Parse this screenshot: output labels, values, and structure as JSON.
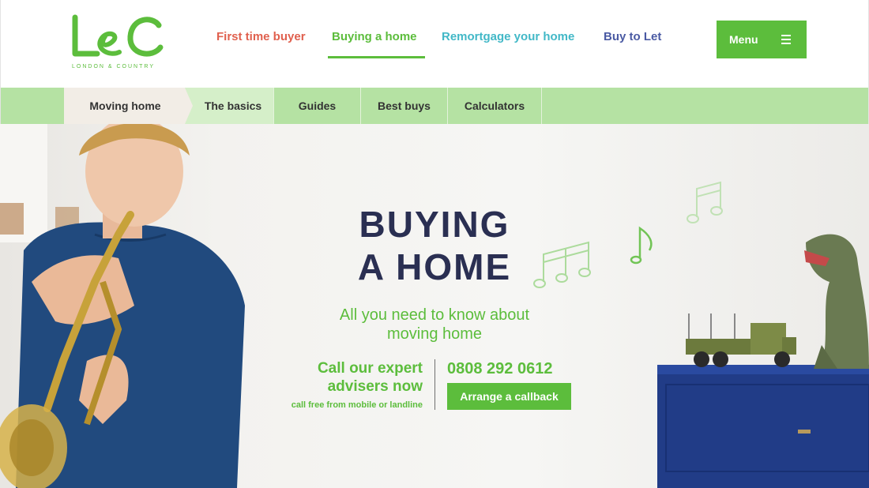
{
  "brand": {
    "logo_letters": "L&C",
    "logo_tagline": "LONDON & COUNTRY"
  },
  "colors": {
    "green": "#5cbd3c",
    "red": "#e0604e",
    "teal": "#42b8c7",
    "navy": "#4a5aa3",
    "title": "#2a2f52"
  },
  "topnav": {
    "items": [
      {
        "label": "First time buyer"
      },
      {
        "label": "Buying a home",
        "active": true
      },
      {
        "label": "Remortgage your home"
      },
      {
        "label": "Buy to Let"
      }
    ],
    "menu_label": "Menu",
    "menu_icon": "hamburger-icon"
  },
  "subnav": {
    "items": [
      {
        "label": "Moving home",
        "active": true
      },
      {
        "label": "The basics"
      },
      {
        "label": "Guides"
      },
      {
        "label": "Best buys"
      },
      {
        "label": "Calculators"
      }
    ]
  },
  "hero": {
    "title_line1": "BUYING",
    "title_line2": "A HOME",
    "subtitle_line1": "All you need to know about",
    "subtitle_line2": "moving home",
    "cta_heading_line1": "Call our expert",
    "cta_heading_line2": "advisers now",
    "cta_note": "call free from mobile or landline",
    "phone": "0808 292 0612",
    "callback_label": "Arrange a callback"
  }
}
